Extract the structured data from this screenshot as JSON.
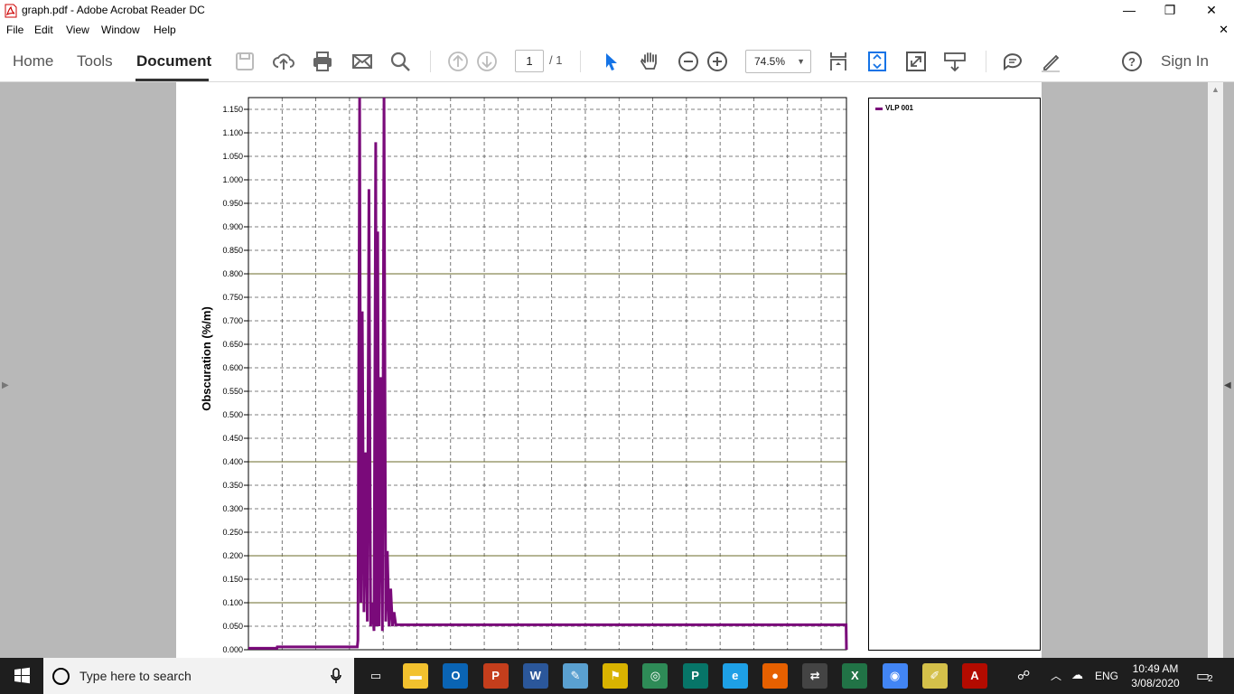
{
  "window": {
    "title": "graph.pdf - Adobe Acrobat Reader DC",
    "minimize_glyph": "—",
    "restore_glyph": "❐",
    "close_glyph": "✕",
    "doc_close_glyph": "✕"
  },
  "menu": {
    "items": [
      "File",
      "Edit",
      "View",
      "Window",
      "Help"
    ]
  },
  "toolbar": {
    "tabs": [
      "Home",
      "Tools",
      "Document"
    ],
    "active_tab": "Document",
    "page_current": "1",
    "page_total": "/ 1",
    "zoom": "74.5%",
    "sign_in": "Sign In",
    "icons": [
      "save-icon",
      "cloud-upload-icon",
      "print-icon",
      "email-icon",
      "search-icon",
      "page-up-icon",
      "page-down-icon",
      "select-cursor-icon",
      "hand-icon",
      "zoom-out-icon",
      "zoom-in-icon",
      "fit-page-icon",
      "scroll-mode-icon",
      "full-screen-icon",
      "read-mode-icon",
      "comment-icon",
      "highlight-pen-icon",
      "help-icon"
    ]
  },
  "chart_data": {
    "type": "line",
    "title": "",
    "xlabel": "",
    "ylabel": "Obscuration (%/m)",
    "ylim": [
      0,
      1.175
    ],
    "yticks": [
      "0.000",
      "0.050",
      "0.100",
      "0.150",
      "0.200",
      "0.250",
      "0.300",
      "0.350",
      "0.400",
      "0.450",
      "0.500",
      "0.550",
      "0.600",
      "0.650",
      "0.700",
      "0.750",
      "0.800",
      "0.850",
      "0.900",
      "0.950",
      "1.000",
      "1.050",
      "1.100",
      "1.150"
    ],
    "grid": true,
    "major_lines": [
      0.1,
      0.2,
      0.4,
      0.8
    ],
    "legend_placement": "right",
    "series": [
      {
        "name": "VLP 001",
        "color": "#7a0a7a",
        "x": [
          0,
          8.5,
          8.6,
          32.5,
          32.7,
          33.2,
          33.6,
          34.0,
          34.5,
          35.0,
          35.5,
          36.0,
          36.5,
          37.0,
          37.5,
          38.0,
          38.3,
          38.6,
          39.0,
          39.5,
          40.0,
          40.5,
          41.0,
          41.5,
          42.0,
          42.5,
          43.0,
          43.5,
          44.0,
          44.5,
          45.0,
          45.5,
          178.5,
          178.6
        ],
        "values": [
          0.003,
          0.003,
          0.006,
          0.006,
          0.02,
          1.18,
          0.1,
          0.72,
          0.08,
          0.42,
          0.06,
          0.98,
          0.05,
          0.1,
          0.04,
          1.08,
          0.05,
          0.89,
          0.05,
          0.58,
          0.04,
          1.18,
          0.06,
          0.21,
          0.05,
          0.13,
          0.05,
          0.08,
          0.053,
          0.053,
          0.053,
          0.053,
          0.053,
          0.0
        ]
      }
    ]
  },
  "taskbar": {
    "search_placeholder": "Type here to search",
    "apps": [
      {
        "name": "task-view",
        "glyph": "▭"
      },
      {
        "name": "file-explorer",
        "glyph": "▬"
      },
      {
        "name": "outlook",
        "glyph": "O"
      },
      {
        "name": "powerpoint",
        "glyph": "P"
      },
      {
        "name": "word",
        "glyph": "W"
      },
      {
        "name": "paint",
        "glyph": "✎"
      },
      {
        "name": "app-yellow",
        "glyph": "⚑"
      },
      {
        "name": "network-app",
        "glyph": "◎"
      },
      {
        "name": "publisher",
        "glyph": "P"
      },
      {
        "name": "internet-explorer",
        "glyph": "e"
      },
      {
        "name": "firefox",
        "glyph": "●"
      },
      {
        "name": "sync-app",
        "glyph": "⇄"
      },
      {
        "name": "excel",
        "glyph": "X"
      },
      {
        "name": "chrome",
        "glyph": "◉"
      },
      {
        "name": "notes-app",
        "glyph": "✐"
      },
      {
        "name": "acrobat",
        "glyph": "A"
      }
    ],
    "language": "ENG",
    "time": "10:49 AM",
    "date": "3/08/2020",
    "notification_count": "2"
  }
}
